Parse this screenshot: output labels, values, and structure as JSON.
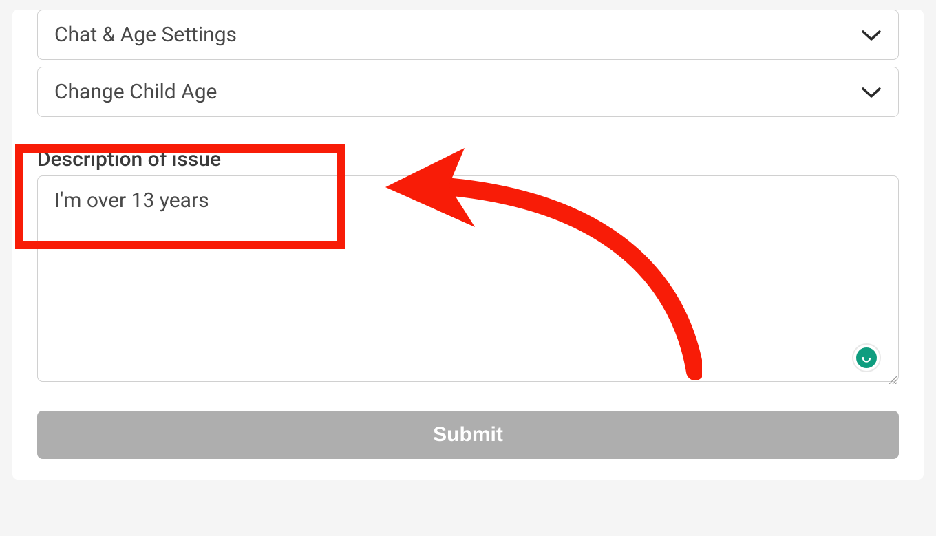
{
  "form": {
    "dropdown_chat": "Chat & Age Settings",
    "dropdown_change": "Change Child Age",
    "description_label": "Description of issue",
    "description_value": "I'm over 13 years",
    "submit_label": "Submit"
  },
  "annotations": {
    "box_color": "#f81c07",
    "arrow_color": "#f81c07"
  }
}
